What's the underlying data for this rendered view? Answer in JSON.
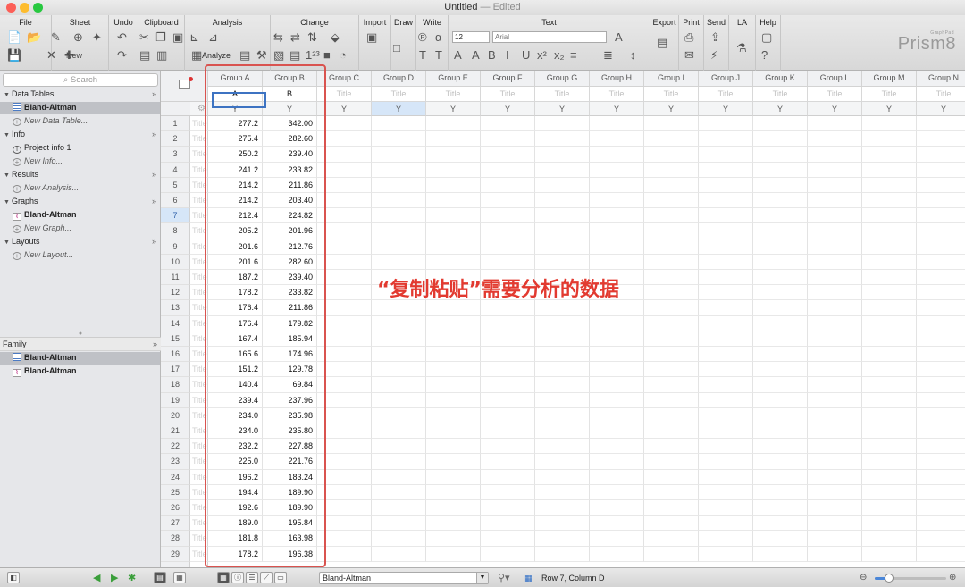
{
  "window": {
    "title": "Untitled",
    "edited": "— Edited"
  },
  "toolbar": {
    "groups": [
      "File",
      "Sheet",
      "Undo",
      "Clipboard",
      "Analysis",
      "Change",
      "Import",
      "Draw",
      "Write",
      "Text",
      "Export",
      "Print",
      "Send",
      "LA",
      "Help"
    ],
    "new_label": "New",
    "analyze_label": "Analyze",
    "font_size": "12",
    "font_name": "Arial",
    "logo": "Prism8",
    "logo_small": "GraphPad"
  },
  "sidebar": {
    "search_placeholder": "Search",
    "sections": {
      "data_tables": {
        "label": "Data Tables",
        "items": [
          "Bland-Altman"
        ],
        "new": "New Data Table..."
      },
      "info": {
        "label": "Info",
        "items": [
          "Project info 1"
        ],
        "new": "New Info..."
      },
      "results": {
        "label": "Results",
        "new": "New Analysis..."
      },
      "graphs": {
        "label": "Graphs",
        "items": [
          "Bland-Altman"
        ],
        "new": "New Graph..."
      },
      "layouts": {
        "label": "Layouts",
        "new": "New Layout..."
      }
    },
    "family": {
      "label": "Family",
      "items": [
        "Bland-Altman",
        "Bland-Altman"
      ]
    }
  },
  "sheet": {
    "columns": [
      "Group A",
      "Group B",
      "Group C",
      "Group D",
      "Group E",
      "Group F",
      "Group G",
      "Group H",
      "Group I",
      "Group J",
      "Group K",
      "Group L",
      "Group M",
      "Group N"
    ],
    "titles": [
      "A",
      "B",
      "Title",
      "Title",
      "Title",
      "Title",
      "Title",
      "Title",
      "Title",
      "Title",
      "Title",
      "Title",
      "Title",
      "Title"
    ],
    "sub_label": "Y",
    "row_title_placeholder": "Title",
    "rows": [
      {
        "n": "1",
        "a": "277.2",
        "b": "342.00"
      },
      {
        "n": "2",
        "a": "275.4",
        "b": "282.60"
      },
      {
        "n": "3",
        "a": "250.2",
        "b": "239.40"
      },
      {
        "n": "4",
        "a": "241.2",
        "b": "233.82"
      },
      {
        "n": "5",
        "a": "214.2",
        "b": "211.86"
      },
      {
        "n": "6",
        "a": "214.2",
        "b": "203.40"
      },
      {
        "n": "7",
        "a": "212.4",
        "b": "224.82"
      },
      {
        "n": "8",
        "a": "205.2",
        "b": "201.96"
      },
      {
        "n": "9",
        "a": "201.6",
        "b": "212.76"
      },
      {
        "n": "10",
        "a": "201.6",
        "b": "282.60"
      },
      {
        "n": "11",
        "a": "187.2",
        "b": "239.40"
      },
      {
        "n": "12",
        "a": "178.2",
        "b": "233.82"
      },
      {
        "n": "13",
        "a": "176.4",
        "b": "211.86"
      },
      {
        "n": "14",
        "a": "176.4",
        "b": "179.82"
      },
      {
        "n": "15",
        "a": "167.4",
        "b": "185.94"
      },
      {
        "n": "16",
        "a": "165.6",
        "b": "174.96"
      },
      {
        "n": "17",
        "a": "151.2",
        "b": "129.78"
      },
      {
        "n": "18",
        "a": "140.4",
        "b": "69.84"
      },
      {
        "n": "19",
        "a": "239.4",
        "b": "237.96"
      },
      {
        "n": "20",
        "a": "234.0",
        "b": "235.98"
      },
      {
        "n": "21",
        "a": "234.0",
        "b": "235.80"
      },
      {
        "n": "22",
        "a": "232.2",
        "b": "227.88"
      },
      {
        "n": "23",
        "a": "225.0",
        "b": "221.76"
      },
      {
        "n": "24",
        "a": "196.2",
        "b": "183.24"
      },
      {
        "n": "25",
        "a": "194.4",
        "b": "189.90"
      },
      {
        "n": "26",
        "a": "192.6",
        "b": "189.90"
      },
      {
        "n": "27",
        "a": "189.0",
        "b": "195.84"
      },
      {
        "n": "28",
        "a": "181.8",
        "b": "163.98"
      },
      {
        "n": "29",
        "a": "178.2",
        "b": "196.38"
      }
    ],
    "selected_row": "7",
    "selected_column": "Group D"
  },
  "annotation": "“复制粘贴”需要分析的数据",
  "status": {
    "sheet_name": "Bland-Altman",
    "position": "Row 7, Column D",
    "zoom_fraction": 0.2
  },
  "colors": {
    "red_annotation": "#e23a30",
    "selection_blue": "#3d73c2",
    "close": "#fc5f57",
    "minimize": "#fdbc2e",
    "zoom": "#28c840"
  }
}
